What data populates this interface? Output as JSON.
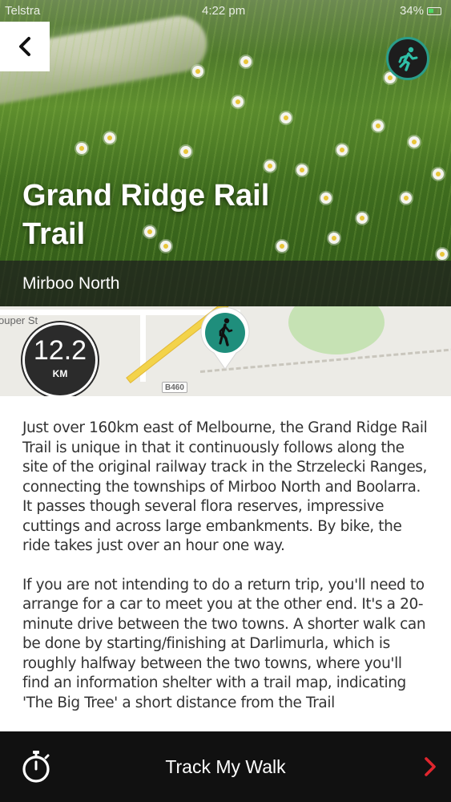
{
  "status_bar": {
    "carrier": "Telstra",
    "time": "4:22 pm",
    "battery": "34%"
  },
  "hero": {
    "title": "Grand Ridge Rail Trail",
    "location": "Mirboo North"
  },
  "map": {
    "street_label": "ouper St",
    "road_shield": "B460",
    "distance_value": "12.2",
    "distance_unit": "KM"
  },
  "description": {
    "paragraphs": [
      "Just over 160km east of Melbourne, the Grand Ridge Rail Trail is unique in that it continuously follows along the site of the original railway track in the Strzelecki Ranges, connecting the townships of Mirboo North and Boolarra. It passes though several flora reserves, impressive cuttings and across large embankments. By bike, the ride takes just over an hour one way.",
      "If you are not intending to do a return trip, you'll need to arrange for a car to meet you at the other end. It's a 20-minute drive between the two towns. A shorter walk can be done by starting/finishing at Darlimurla, which is roughly halfway between the two towns, where you'll find an information shelter with a trail map, indicating 'The Big Tree' a short distance from the Trail"
    ]
  },
  "bottom_bar": {
    "label": "Track My Walk"
  },
  "colors": {
    "accent_teal": "#2a9d8a",
    "chevron_red": "#e0262e",
    "bar_dark": "#111111"
  },
  "icons": [
    "chevron-left-icon",
    "walking-person-icon",
    "stopwatch-icon",
    "chevron-right-icon"
  ]
}
